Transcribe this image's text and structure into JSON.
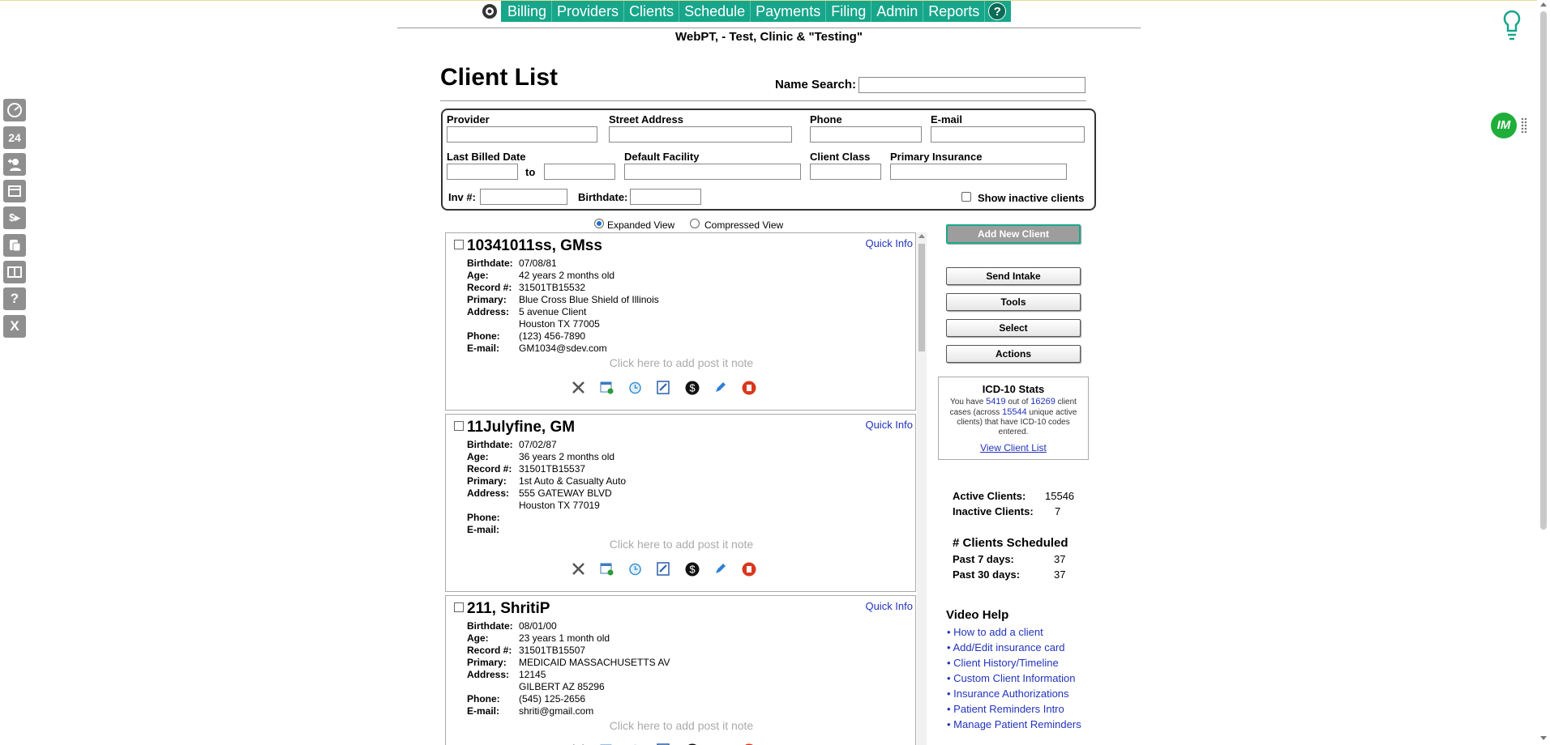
{
  "nav": {
    "items": [
      "Billing",
      "Providers",
      "Clients",
      "Schedule",
      "Payments",
      "Filing",
      "Admin",
      "Reports"
    ],
    "help": "?"
  },
  "clinic_name": "WebPT, - Test, Clinic & \"Testing\"",
  "left_toolbar": [
    "dashboard-icon",
    "calendar-24-icon",
    "add-client-icon",
    "inbox-icon",
    "payment-icon",
    "notes-icon",
    "book-icon",
    "help-icon",
    "close-icon"
  ],
  "page_title": "Client List",
  "search": {
    "label": "Name Search:",
    "value": ""
  },
  "filters": {
    "provider": "Provider",
    "street_address": "Street Address",
    "phone": "Phone",
    "email": "E-mail",
    "last_billed_date": "Last Billed Date",
    "to": "to",
    "default_facility": "Default Facility",
    "client_class": "Client Class",
    "primary_insurance": "Primary Insurance",
    "inv": "Inv #:",
    "birthdate": "Birthdate:",
    "show_inactive": "Show inactive clients"
  },
  "view": {
    "expanded": "Expanded View",
    "compressed": "Compressed View",
    "selected": "Expanded View"
  },
  "field_labels": {
    "birthdate": "Birthdate:",
    "age": "Age:",
    "record": "Record #:",
    "primary": "Primary:",
    "address": "Address:",
    "phone": "Phone:",
    "email": "E-mail:",
    "quick_info": "Quick Info",
    "postit": "Click here to add post it note"
  },
  "clients": [
    {
      "name": "10341011ss, GMss",
      "birthdate": "07/08/81",
      "age": "42 years 2 months old",
      "record": "31501TB15532",
      "primary": "Blue Cross Blue Shield of Illinois",
      "address1": "5 avenue Client",
      "address2": "Houston TX 77005",
      "phone": "(123) 456-7890",
      "email": "GM1034@sdev.com"
    },
    {
      "name": "11Julyfine, GM",
      "birthdate": "07/02/87",
      "age": "36 years 2 months old",
      "record": "31501TB15537",
      "primary": "1st Auto & Casualty Auto",
      "address1": "555 GATEWAY BLVD",
      "address2": "Houston TX 77019",
      "phone": "",
      "email": ""
    },
    {
      "name": "211, ShritiP",
      "birthdate": "08/01/00",
      "age": "23 years 1 month old",
      "record": "31501TB15507",
      "primary": "MEDICAID MASSACHUSETTS AV",
      "address1": "12145",
      "address2": "GILBERT AZ 85296",
      "phone": "(545) 125-2656",
      "email": "shriti@gmail.com"
    }
  ],
  "actions": {
    "add_new_client": "Add New Client",
    "send_intake": "Send Intake",
    "tools": "Tools",
    "select": "Select",
    "actions": "Actions"
  },
  "icd10": {
    "title": "ICD-10 Stats",
    "you_have": "You have",
    "count": "5419",
    "out_of": "out of",
    "total": "16269",
    "client_cases": "client cases (across",
    "unique": "15544",
    "tail": "unique active clients) that have ICD-10 codes entered.",
    "link": "View Client List"
  },
  "counts": {
    "active_label": "Active Clients:",
    "active": "15546",
    "inactive_label": "Inactive Clients:",
    "inactive": "7"
  },
  "scheduled": {
    "title": "# Clients Scheduled",
    "past7_label": "Past 7 days:",
    "past7": "37",
    "past30_label": "Past 30 days:",
    "past30": "37"
  },
  "video_help": {
    "title": "Video Help",
    "links": [
      "How to add a client",
      "Add/Edit insurance card",
      "Client History/Timeline",
      "Custom Client Information",
      "Insurance Authorizations",
      "Patient Reminders Intro",
      "Manage Patient Reminders"
    ]
  },
  "badge": "IM",
  "colors": {
    "nav": "#17a68a",
    "link": "#2233bb",
    "badge": "#1fae3a"
  }
}
